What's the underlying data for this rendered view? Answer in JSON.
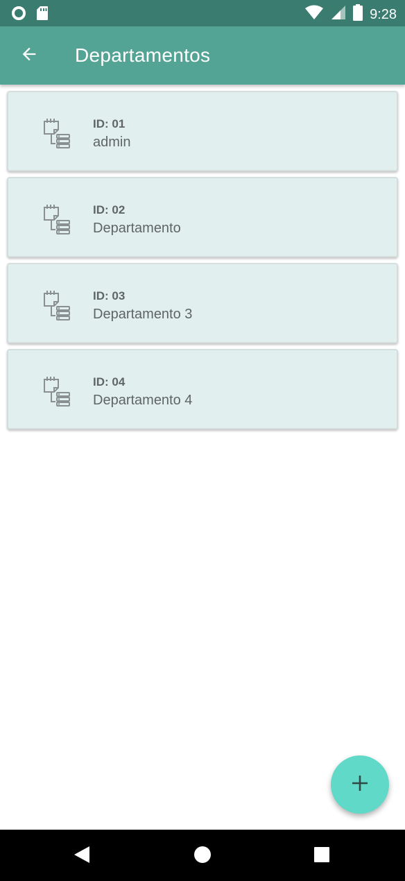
{
  "status_bar": {
    "time": "9:28",
    "icons": [
      "circle-notification-icon",
      "sd-card-icon",
      "wifi-icon",
      "cell-signal-icon",
      "battery-icon"
    ]
  },
  "app_bar": {
    "title": "Departamentos",
    "back_icon": "arrow-back-icon",
    "background": "#54a496"
  },
  "departments": [
    {
      "id_label": "ID: 01",
      "name": "admin"
    },
    {
      "id_label": "ID: 02",
      "name": "Departamento"
    },
    {
      "id_label": "ID: 03",
      "name": "Departamento 3"
    },
    {
      "id_label": "ID: 04",
      "name": "Departamento 4"
    }
  ],
  "fab": {
    "icon": "plus-icon",
    "color": "#61d9c8"
  },
  "nav_bar": {
    "icons": [
      "nav-back-icon",
      "nav-home-icon",
      "nav-recents-icon"
    ]
  }
}
